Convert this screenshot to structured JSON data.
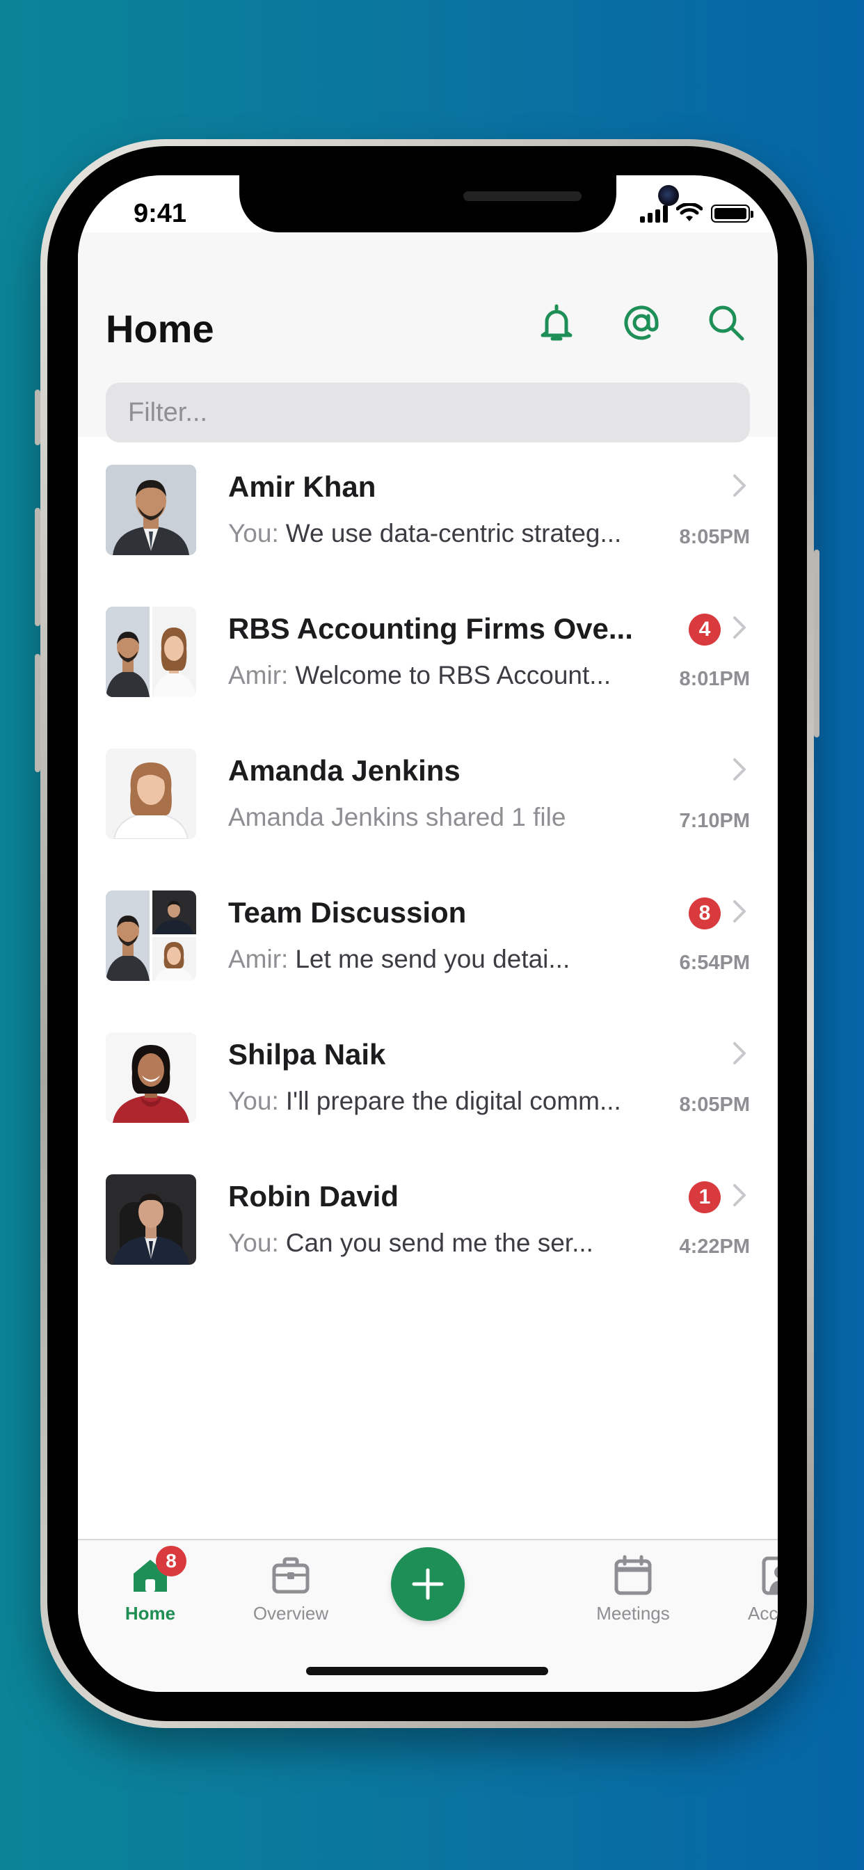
{
  "status_bar": {
    "time": "9:41"
  },
  "header": {
    "title": "Home",
    "filter_placeholder": "Filter..."
  },
  "icons": {
    "notifications": "bell-icon",
    "mentions": "at-sign-icon",
    "search": "search-icon"
  },
  "colors": {
    "accent": "#1f8f58",
    "badge": "#d93a3e",
    "background_start": "#0b8497",
    "background_end": "#0565a6"
  },
  "conversations": [
    {
      "name": "Amir Khan",
      "sender": "You:",
      "preview": "We use data-centric strateg...",
      "time": "8:05PM",
      "unread": null
    },
    {
      "name": "RBS Accounting Firms Ove...",
      "sender": "Amir:",
      "preview": "Welcome to RBS Account...",
      "time": "8:01PM",
      "unread": "4"
    },
    {
      "name": "Amanda Jenkins",
      "sender": "",
      "preview": "Amanda Jenkins shared 1 file",
      "time": "7:10PM",
      "unread": null
    },
    {
      "name": "Team Discussion",
      "sender": "Amir:",
      "preview": "Let me send you detai...",
      "time": "6:54PM",
      "unread": "8"
    },
    {
      "name": "Shilpa Naik",
      "sender": "You:",
      "preview": "I'll prepare the digital comm...",
      "time": "8:05PM",
      "unread": null
    },
    {
      "name": "Robin David",
      "sender": "You:",
      "preview": "Can you send me the ser...",
      "time": "4:22PM",
      "unread": "1"
    }
  ],
  "tabbar": {
    "home": {
      "label": "Home",
      "badge": "8"
    },
    "overview": {
      "label": "Overview"
    },
    "new": {
      "icon": "plus-icon"
    },
    "meetings": {
      "label": "Meetings"
    },
    "account": {
      "label": "Account"
    }
  }
}
